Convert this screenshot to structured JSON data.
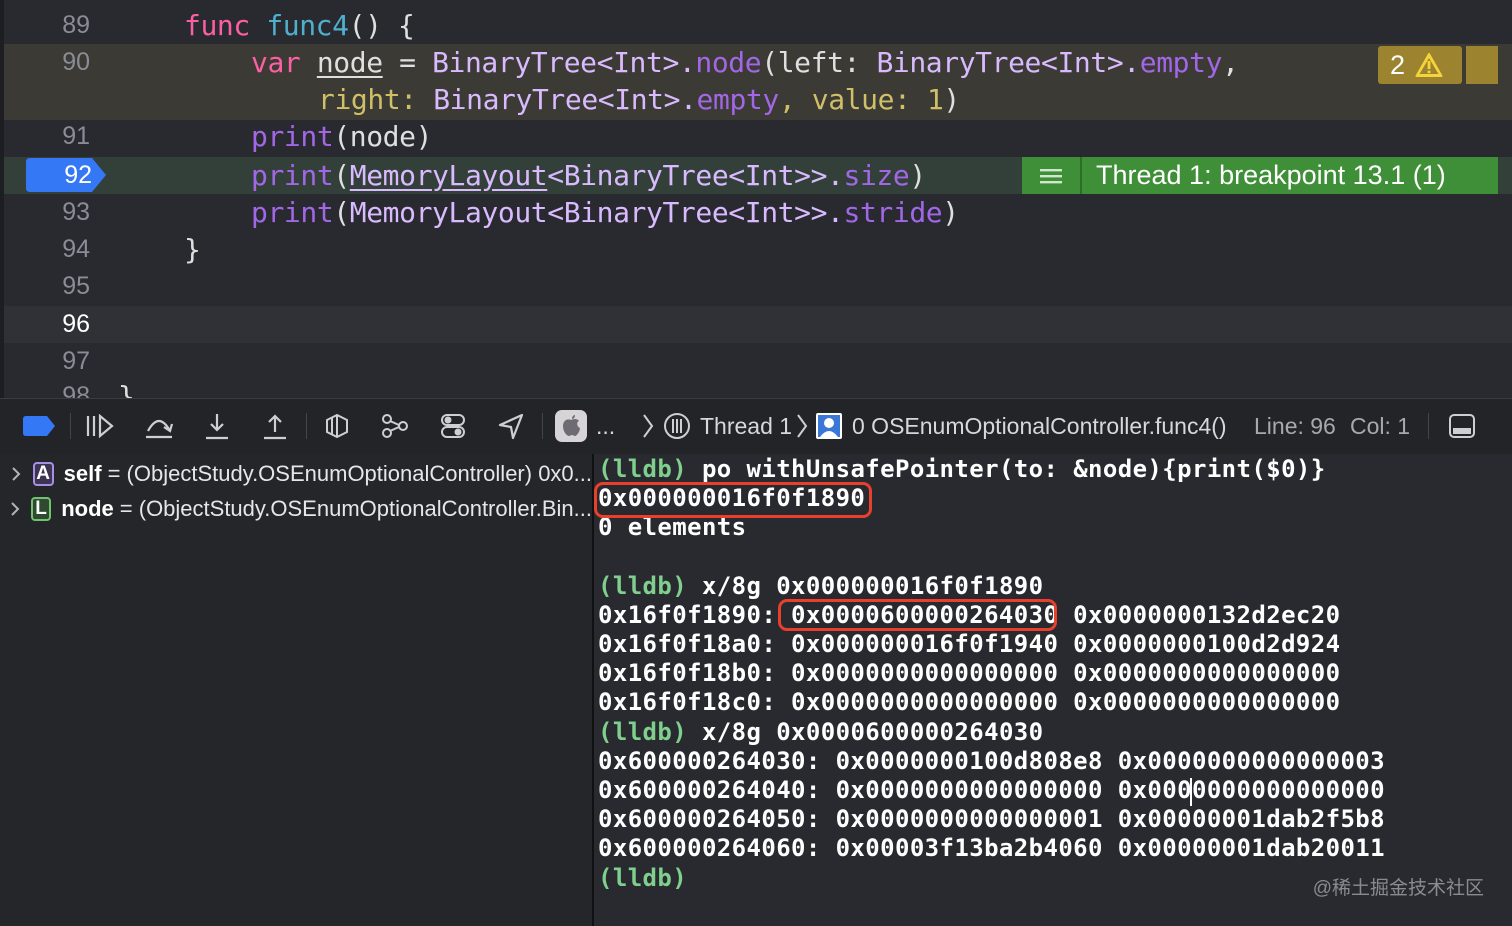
{
  "editor": {
    "lines": [
      {
        "number": "89"
      },
      {
        "number": "90"
      },
      {
        "number": "91"
      },
      {
        "number": "92"
      },
      {
        "number": "93"
      },
      {
        "number": "94"
      },
      {
        "number": "95"
      },
      {
        "number": "96"
      },
      {
        "number": "97"
      },
      {
        "number": "98"
      }
    ],
    "code": {
      "l89": {
        "kw": "func",
        "name": "func4",
        "rest": "() {"
      },
      "l90a": {
        "kw": "var",
        "var": "node",
        "eq": " = ",
        "t1": "BinaryTree",
        "g1": "<Int>.",
        "m1": "node",
        "p1": "(left: ",
        "t2": "BinaryTree",
        "g2": "<Int>.",
        "m2": "empty",
        "c": ","
      },
      "l90b": {
        "lbl": "right: ",
        "t": "BinaryTree",
        "g": "<Int>.",
        "m": "empty",
        "c": ", value: ",
        "n": "1",
        "e": ")"
      },
      "l91": {
        "fn": "print",
        "rest": "(node)"
      },
      "l92": {
        "fn": "print",
        "p": "(",
        "ml": "MemoryLayout",
        "g": "<BinaryTree<Int>>.",
        "m": "size",
        "e": ")"
      },
      "l93": {
        "fn": "print",
        "p": "(",
        "ml": "MemoryLayout",
        "g": "<BinaryTree<Int>>.",
        "m": "stride",
        "e": ")"
      },
      "l94": "}",
      "l98": "}"
    },
    "warning_count": "2",
    "breakpoint_message": "Thread 1: breakpoint 13.1 (1)",
    "colors": {
      "breakpoint": "#3478f6",
      "breakpoint_band": "#3f8f38",
      "warning": "#9c8330"
    }
  },
  "debugbar": {
    "app_ellipsis": "...",
    "thread": "Thread 1",
    "frame": "0 OSEnumOptionalController.func4()",
    "line": "Line: 96",
    "col": "Col: 1"
  },
  "variables": [
    {
      "kind": "A",
      "name": "self",
      "value": "= (ObjectStudy.OSEnumOptionalController) 0x0..."
    },
    {
      "kind": "L",
      "name": "node",
      "value": "= (ObjectStudy.OSEnumOptionalController.Bin..."
    }
  ],
  "console": {
    "lines": [
      {
        "prompt": "(lldb)",
        "text": " po withUnsafePointer(to: &node){print($0)}"
      },
      {
        "prompt": "",
        "text": "0x000000016f0f1890"
      },
      {
        "prompt": "",
        "text": "0 elements"
      },
      {
        "prompt": "",
        "text": ""
      },
      {
        "prompt": "(lldb)",
        "text": " x/8g 0x000000016f0f1890"
      },
      {
        "prompt": "",
        "text": "0x16f0f1890: 0x0000600000264030 0x0000000132d2ec20"
      },
      {
        "prompt": "",
        "text": "0x16f0f18a0: 0x000000016f0f1940 0x0000000100d2d924"
      },
      {
        "prompt": "",
        "text": "0x16f0f18b0: 0x0000000000000000 0x0000000000000000"
      },
      {
        "prompt": "",
        "text": "0x16f0f18c0: 0x0000000000000000 0x0000000000000000"
      },
      {
        "prompt": "(lldb)",
        "text": " x/8g 0x0000600000264030"
      },
      {
        "prompt": "",
        "text": "0x600000264030: 0x0000000100d808e8 0x0000000000000003"
      },
      {
        "prompt": "",
        "text": "0x600000264040: 0x0000000000000000 0x0000000000000000"
      },
      {
        "prompt": "",
        "text": "0x600000264050: 0x0000000000000001 0x00000001dab2f5b8"
      },
      {
        "prompt": "",
        "text": "0x600000264060: 0x00003f13ba2b4060 0x00000001dab20011"
      },
      {
        "prompt": "(lldb)",
        "text": ""
      }
    ],
    "watermark": "@稀土掘金技术社区"
  }
}
